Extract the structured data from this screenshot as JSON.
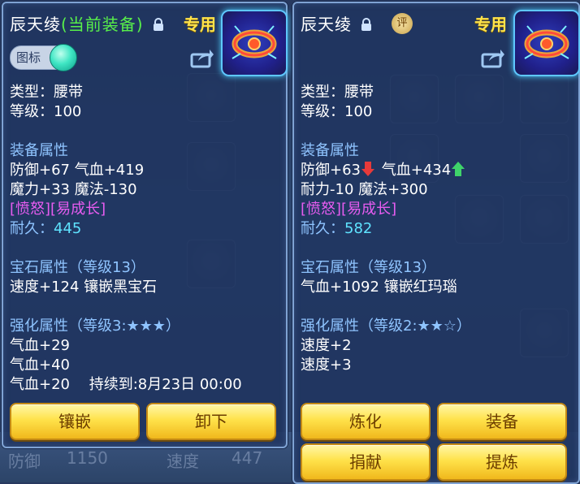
{
  "left_panel": {
    "title": "辰天绫",
    "title_status": "(当前装备)",
    "exclusive_label": "专用",
    "toggle_label": "图标",
    "type": "类型：腰带",
    "level": "等级：100",
    "equip_attr_header": "装备属性",
    "equip_attr_lines": [
      "防御+67 气血+419",
      "魔力+33 魔法-130"
    ],
    "tags": "[愤怒][易成长]",
    "durability_label": "耐久：",
    "durability_value": "445",
    "gem_header": "宝石属性（等级13）",
    "gem_line": "速度+124 镶嵌黑宝石",
    "enhance_header": "强化属性（等级3:★★★）",
    "enhance_lines": [
      "气血+29",
      "气血+40",
      "气血+20　 持续到:8月23日 00:00"
    ],
    "buttons": [
      "镶嵌",
      "卸下"
    ]
  },
  "right_panel": {
    "title": "辰天绫",
    "eval_badge": "评",
    "exclusive_label": "专用",
    "type": "类型：腰带",
    "level": "等级：100",
    "equip_attr_header": "装备属性",
    "defense": "防御+63",
    "hp": "气血+434",
    "line2": "耐力-10 魔法+300",
    "tags": "[愤怒][易成长]",
    "durability_label": "耐久：",
    "durability_value": "582",
    "gem_header": "宝石属性（等级13）",
    "gem_line": "气血+1092 镶嵌红玛瑙",
    "enhance_header": "强化属性（等级2:★★☆）",
    "enhance_lines": [
      "速度+2",
      "速度+3"
    ],
    "buttons": [
      "炼化",
      "装备",
      "捐献",
      "提炼"
    ]
  },
  "background": {
    "bottom_stats": [
      "防御",
      "1150",
      "速度",
      "447"
    ]
  },
  "colors": {
    "panel_bg": "#1f3460",
    "section_header": "#8fc4ff",
    "tags": "#e65cf0",
    "durability": "#5fe3ff",
    "equipped_green": "#58f04a",
    "exclusive_gold": "#ffe34a",
    "button_gold": "#ffe24a",
    "arrow_down": "#e83a3a",
    "arrow_up": "#3fd46a"
  },
  "icons": {
    "lock": "lock-icon",
    "share": "share-icon",
    "item": "belt-item-icon",
    "down": "down-arrow-icon",
    "up": "up-arrow-icon"
  }
}
